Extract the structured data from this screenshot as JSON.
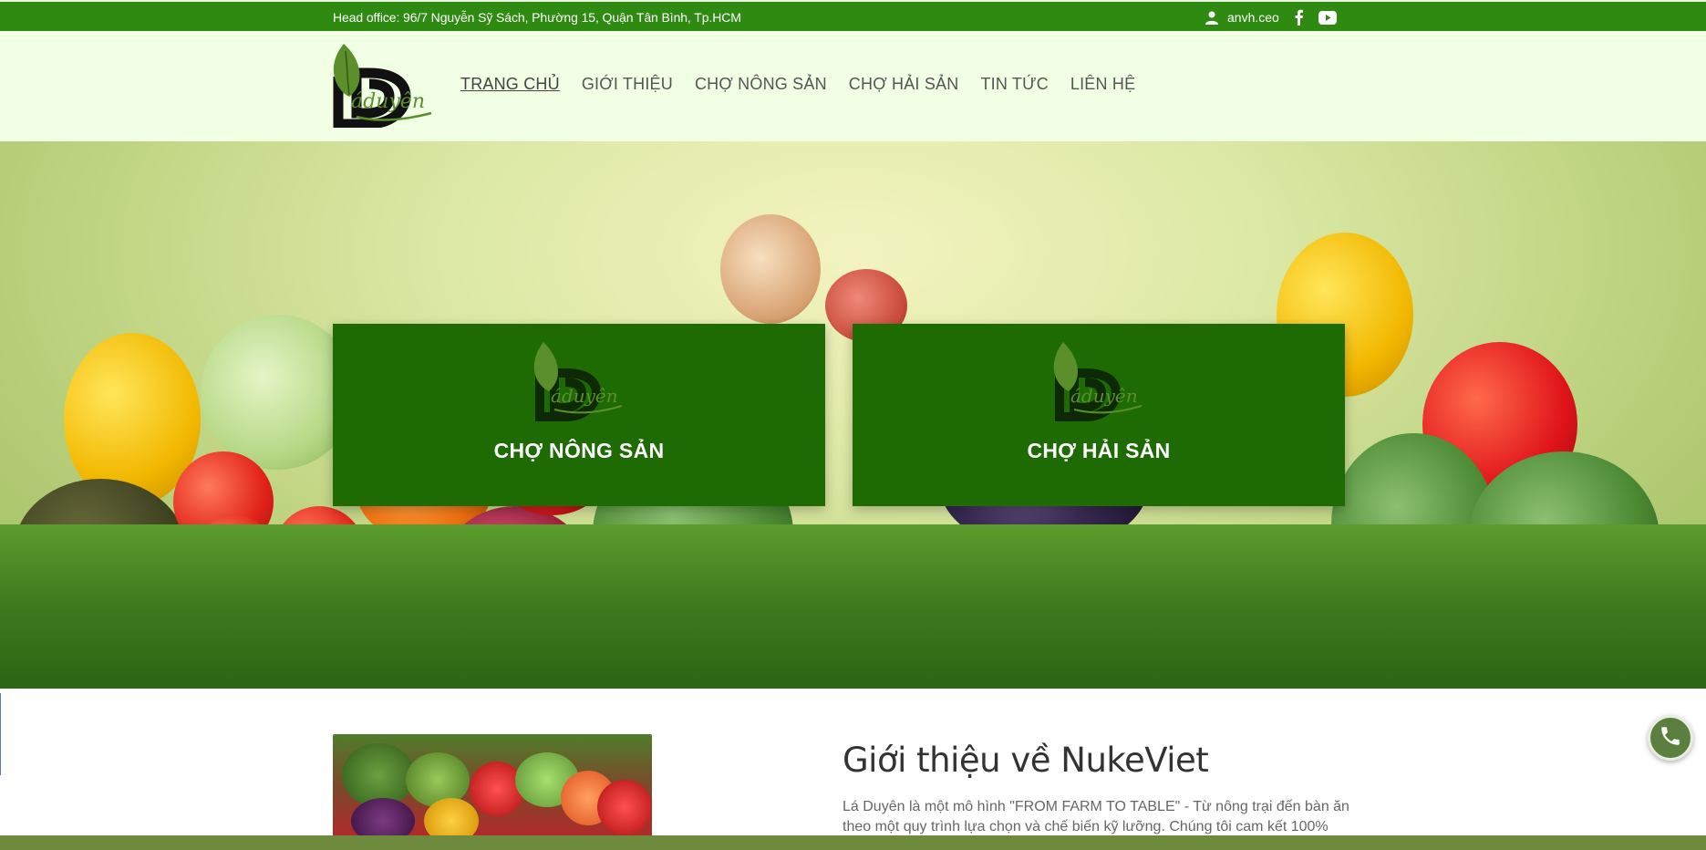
{
  "topbar": {
    "address": "Head office: 96/7 Nguyễn Sỹ Sách, Phường 15, Quận Tân Bình, Tp.HCM",
    "username": "anvh.ceo",
    "user_icon": "user-icon",
    "facebook_icon": "facebook-icon",
    "youtube_icon": "youtube-icon"
  },
  "header": {
    "logo_text": "Láduyên",
    "nav": [
      {
        "label": "TRANG CHỦ",
        "active": true
      },
      {
        "label": "GIỚI THIỆU"
      },
      {
        "label": "CHỢ NÔNG SẢN"
      },
      {
        "label": "CHỢ HẢI SẢN"
      },
      {
        "label": "TIN TỨC"
      },
      {
        "label": "LIÊN HỆ"
      }
    ]
  },
  "hero": {
    "cards": [
      {
        "title": "CHỢ NÔNG SẢN",
        "logo_text": "Láduyên"
      },
      {
        "title": "CHỢ HẢI SẢN",
        "logo_text": "Láduyên"
      }
    ]
  },
  "intro": {
    "title": "Giới thiệu về NukeViet",
    "text": "Lá Duyên là một mô hình \"FROM FARM TO TABLE\" - Từ nông trại đến bàn ăn theo một quy trình lựa chọn và chế biến kỹ lưỡng. Chúng tôi cam kết 100%"
  },
  "colors": {
    "topbar": "#2f8a12",
    "header_bg": "#f1ffe5",
    "card": "#1d6b02",
    "bottombar": "#6e8b3d",
    "phone": "#5b7f3f"
  },
  "icons": {
    "phone": "phone-icon"
  }
}
